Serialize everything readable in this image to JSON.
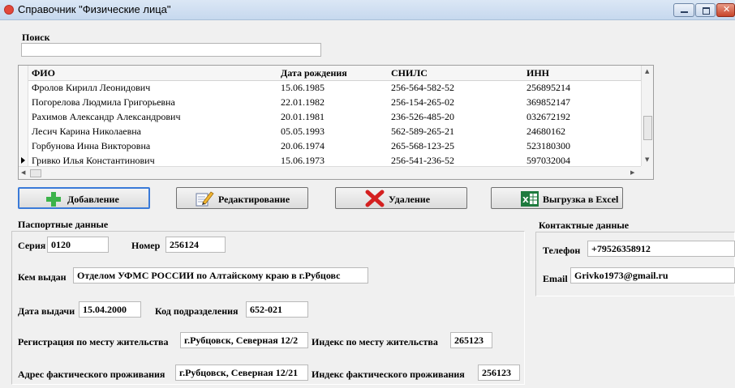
{
  "window": {
    "title": "Справочник \"Физические лица\"",
    "icon": "app-icon"
  },
  "search": {
    "label": "Поиск",
    "value": ""
  },
  "grid": {
    "columns": [
      "ФИО",
      "Дата рождения",
      "СНИЛС",
      "ИНН"
    ],
    "rows": [
      {
        "fio": "Фролов Кирилл Леонидович",
        "birth": "15.06.1985",
        "snils": "256-564-582-52",
        "inn": "256895214"
      },
      {
        "fio": "Погорелова Людмила Григорьевна",
        "birth": "22.01.1982",
        "snils": "256-154-265-02",
        "inn": "369852147"
      },
      {
        "fio": "Рахимов Александр Александрович",
        "birth": "20.01.1981",
        "snils": "236-526-485-20",
        "inn": "032672192"
      },
      {
        "fio": "Лесич Карина Николаевна",
        "birth": "05.05.1993",
        "snils": "562-589-265-21",
        "inn": "24680162"
      },
      {
        "fio": "Горбунова Инна Викторовна",
        "birth": "20.06.1974",
        "snils": "265-568-123-25",
        "inn": "523180300"
      },
      {
        "fio": "Гривко Илья Константинович",
        "birth": "15.06.1973",
        "snils": "256-541-236-52",
        "inn": "597032004"
      }
    ]
  },
  "toolbar": {
    "add_label": "Добавление",
    "edit_label": "Редактирование",
    "delete_label": "Удаление",
    "export_label": "Выгрузка в Excel"
  },
  "passport": {
    "title": "Паспортные данные",
    "series_label": "Серия",
    "series": "0120",
    "number_label": "Номер",
    "number": "256124",
    "issued_by_label": "Кем выдан",
    "issued_by": "Отделом УФМС РОССИИ по Алтайскому краю в г.Рубцовс",
    "issue_date_label": "Дата выдачи",
    "issue_date": "15.04.2000",
    "dept_code_label": "Код подразделения",
    "dept_code": "652-021",
    "reg_label": "Регистрация по месту жительства",
    "reg": "г.Рубцовск, Северная 12/2",
    "reg_index_label": "Индекс по месту жительства",
    "reg_index": "265123",
    "actual_label": "Адрес фактического проживания",
    "actual": "г.Рубцовск, Северная 12/21",
    "actual_index_label": "Индекс фактического проживания",
    "actual_index": "256123"
  },
  "contacts": {
    "title": "Контактные данные",
    "phone_label": "Телефон",
    "phone": "+79526358912",
    "email_label": "Email",
    "email": "Grivko1973@gmail.ru"
  },
  "colors": {
    "accent": "#3a7ad8",
    "titlebar": "#c6d8ee",
    "close": "#c7452a",
    "add_icon": "#3cb34a",
    "delete_icon": "#d42020",
    "excel_icon": "#1e7a3e"
  }
}
